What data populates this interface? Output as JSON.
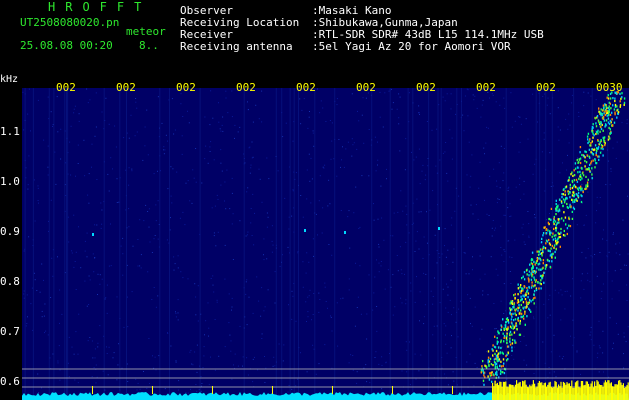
{
  "header": {
    "brand": "HROFFT",
    "filename": "UT2508080020.pn",
    "tag": "meteor",
    "datetime": "25.08.08 00:20",
    "count": "8..",
    "fields": [
      {
        "label": "Observer",
        "value": ":Masaki Kano"
      },
      {
        "label": "Receiving Location",
        "value": ":Shibukawa,Gunma,Japan"
      },
      {
        "label": "Receiver",
        "value": ":RTL-SDR SDR# 43dB L15 114.1MHz USB"
      },
      {
        "label": "Receiving antenna",
        "value": ":5el Yagi Az 20 for Aomori VOR"
      }
    ]
  },
  "spectrogram": {
    "unit": "kHz",
    "y_ticks": [
      "1.1",
      "1.0",
      "0.9",
      "0.8",
      "0.7",
      "0.6"
    ],
    "x_ticks": [
      "002",
      "002",
      "002",
      "002",
      "002",
      "002",
      "002",
      "002",
      "002",
      "0030"
    ],
    "colors": {
      "background": "#000066",
      "labels": "#ffff00",
      "baseline": "#00e0ff",
      "bars": "#ffff00"
    }
  }
}
